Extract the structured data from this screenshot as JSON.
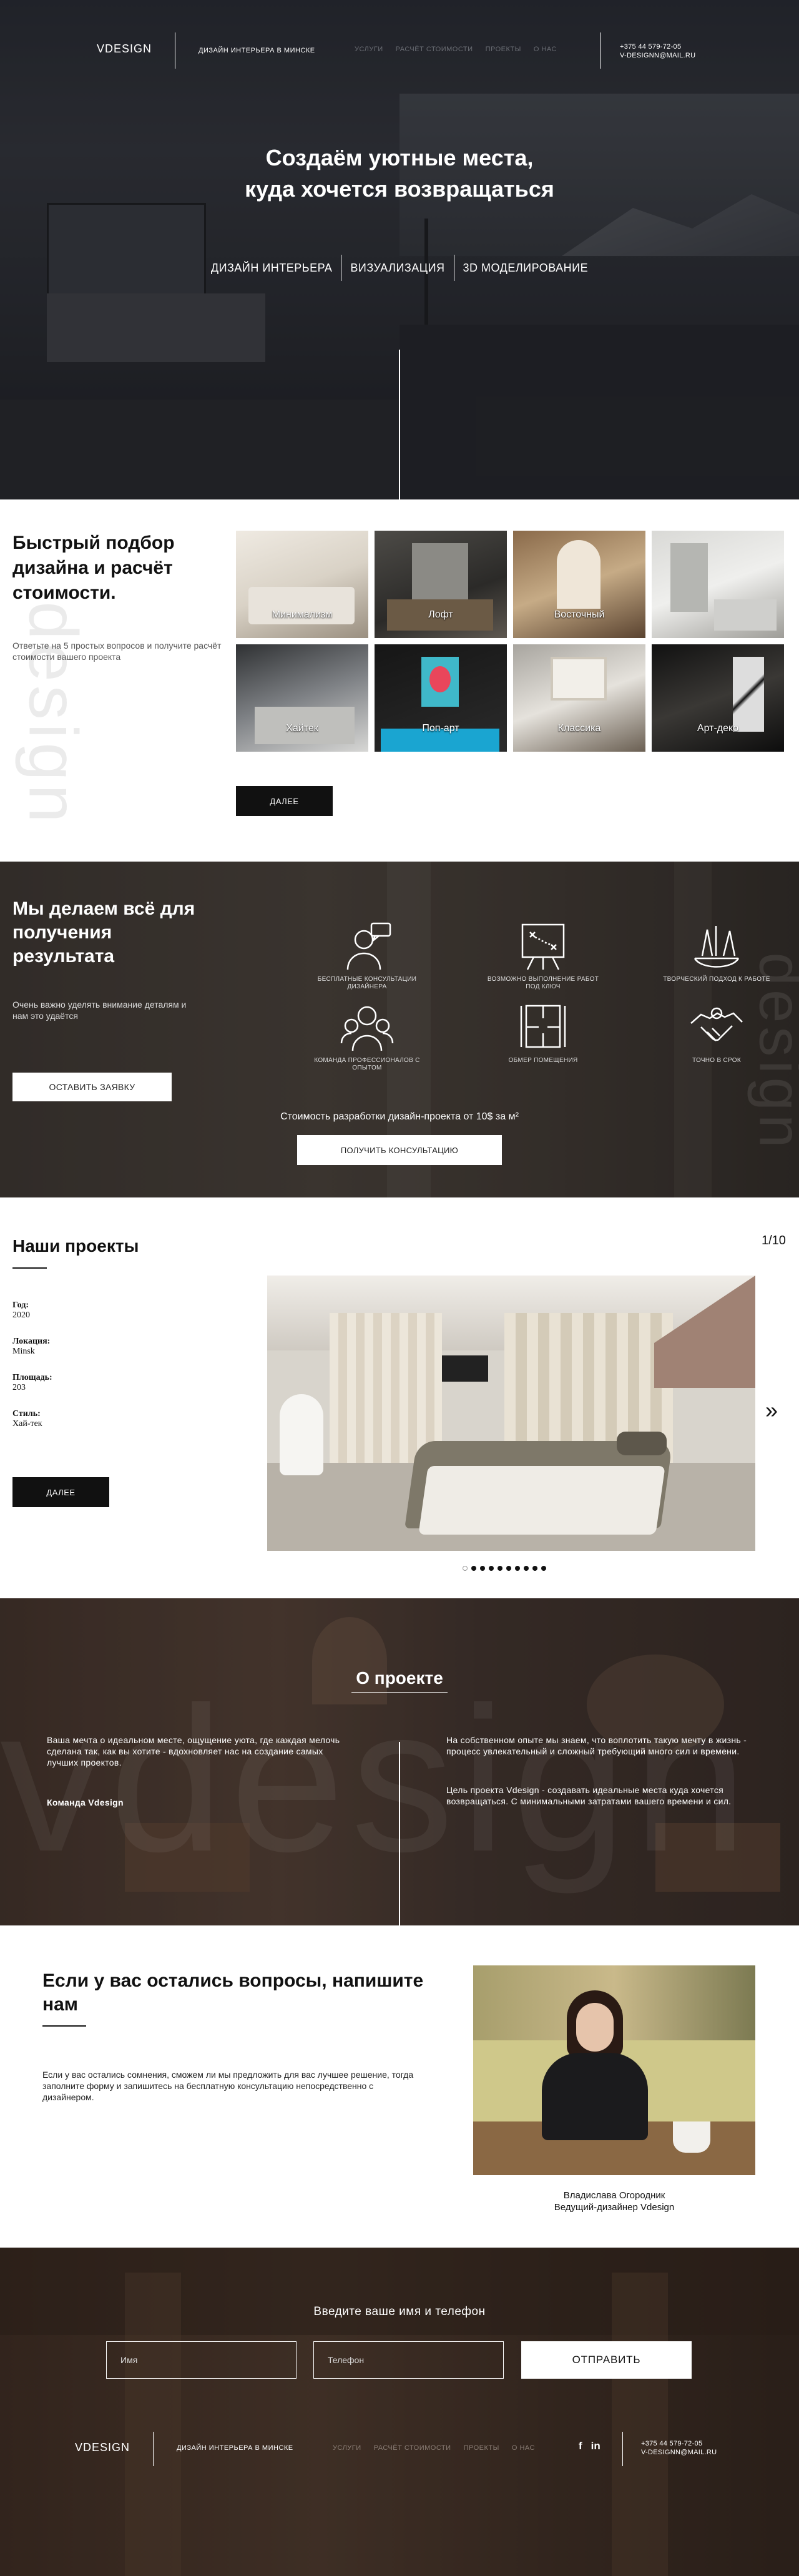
{
  "header": {
    "logo": "VDESIGN",
    "tagline": "ДИЗАЙН ИНТЕРЬЕРА В МИНСКЕ",
    "nav": [
      "УСЛУГИ",
      "РАСЧЁТ СТОИМОСТИ",
      "ПРОЕКТЫ",
      "О НАС"
    ],
    "phone": "+375 44 579-72-05",
    "email": "V-DESIGNN@MAIL.RU"
  },
  "hero": {
    "title_line1": "Создаём уютные места,",
    "title_line2": "куда хочется возвращаться",
    "tabs": [
      "ДИЗАЙН ИНТЕРЬЕРА",
      "ВИЗУАЛИЗАЦИЯ",
      "3D МОДЕЛИРОВАНИЕ"
    ]
  },
  "quiz": {
    "watermark": "design",
    "title_line1": "Быстрый подбор",
    "title_line2": "дизайна и расчёт",
    "title_line3": "стоимости.",
    "subtitle": "Ответьте на 5 простых вопросов и получите расчёт стоимости вашего проекта",
    "styles": [
      "Минимализм",
      "Лофт",
      "Восточный",
      "",
      "Хайтек",
      "Поп-арт",
      "Классика",
      "Арт-деко"
    ],
    "button": "ДАЛЕЕ"
  },
  "services": {
    "title_line1": "Мы делаем всё для",
    "title_line2": "получения",
    "title_line3": "результата",
    "subtitle": "Очень важно уделять внимание деталям и нам это удаётся",
    "request_button": "ОСТАВИТЬ ЗАЯВКУ",
    "watermark": "design",
    "features": [
      {
        "label": "БЕСПЛАТНЫЕ КОНСУЛЬТАЦИИ ДИЗАЙНЕРА",
        "icon": "consultation-icon"
      },
      {
        "label": "ВОЗМОЖНО ВЫПОЛНЕНИЕ РАБОТ ПОД КЛЮЧ",
        "icon": "blueprint-board-icon"
      },
      {
        "label": "ТВОРЧЕСКИЙ ПОДХОД К РАБОТЕ",
        "icon": "creative-tools-icon"
      },
      {
        "label": "КОМАНДА ПРОФЕССИОНАЛОВ С ОПЫТОМ",
        "icon": "team-icon"
      },
      {
        "label": "ОБМЕР ПОМЕЩЕНИЯ",
        "icon": "floor-plan-icon"
      },
      {
        "label": "ТОЧНО В СРОК",
        "icon": "handshake-icon"
      }
    ],
    "price_text": "Стоимость разработки дизайн-проекта от 10$ за м²",
    "consult_button": "ПОЛУЧИТЬ КОНСУЛЬТАЦИЮ"
  },
  "projects": {
    "title": "Наши проекты",
    "counter": "1/10",
    "year_label": "Год:",
    "year": "2020",
    "location_label": "Локация:",
    "location": "Minsk",
    "area_label": "Площадь:",
    "area": "203",
    "style_label": "Стиль:",
    "style": "Хай-тек",
    "button": "ДАЛЕЕ",
    "next_arrow": "»",
    "active_dot": 0,
    "dot_count": 10
  },
  "about": {
    "title": "О проекте",
    "watermark": "vdesign",
    "left_text": "Ваша мечта о идеальном месте, ощущение уюта, где каждая мелочь сделана так, как вы хотите - вдохновляет нас на создание самых лучших проектов.",
    "team": "Команда Vdesign",
    "right_text1": "На собственном опыте мы знаем, что воплотить такую мечту в жизнь - процесс увлекательный и сложный требующий много сил и времени.",
    "right_text2": "Цель проекта Vdesign - создавать идеальные места куда хочется возвращаться. С минимальными затратами вашего времени и сил."
  },
  "contact": {
    "title_line1": "Если у вас остались вопросы, напишите",
    "title_line2": "нам",
    "text": "Если у вас остались сомнения, сможем ли мы предложить для вас лучшее решение, тогда заполните форму и запишитесь на бесплатную консультацию непосредственно с дизайнером.",
    "name": "Владислава Огородник",
    "role": "Ведущий-дизайнер Vdesign"
  },
  "footer": {
    "form_title": "Введите ваше имя и телефон",
    "name_placeholder": "Имя",
    "phone_placeholder": "Телефон",
    "send_button": "ОТПРАВИТЬ",
    "logo": "VDESIGN",
    "tagline": "ДИЗАЙН ИНТЕРЬЕРА В МИНСКЕ",
    "nav": [
      "УСЛУГИ",
      "РАСЧЁТ СТОИМОСТИ",
      "ПРОЕКТЫ",
      "О НАС"
    ],
    "social_facebook": "f",
    "social_linkedin": "in",
    "phone": "+375 44 579-72-05",
    "email": "V-DESIGNN@MAIL.RU"
  }
}
